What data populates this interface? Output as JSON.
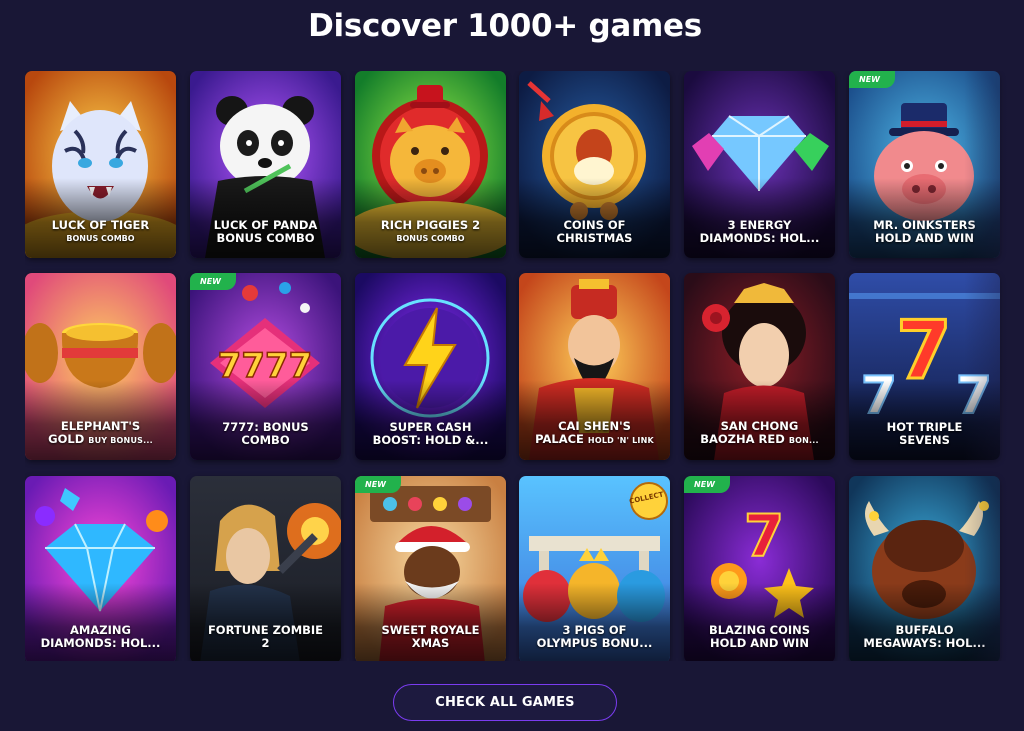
{
  "header": {
    "title": "Discover 1000+ games"
  },
  "badge_text": "NEW",
  "colors": {
    "background": "#191736",
    "new_badge": "#22b24c",
    "cta_border": "#7a3cf0"
  },
  "games": [
    {
      "line1": "LUCK OF TIGER",
      "line2": "BONUS COMBO",
      "line2_style": "sub",
      "new": false,
      "art": "tiger"
    },
    {
      "line1": "LUCK OF PANDA",
      "line2": "BONUS COMBO",
      "line2_style": "main",
      "new": false,
      "art": "panda"
    },
    {
      "line1": "RICH PIGGIES 2",
      "line2": "BONUS COMBO",
      "line2_style": "sub",
      "new": false,
      "art": "piggy"
    },
    {
      "line1": "COINS OF",
      "line2": "CHRISTMAS",
      "line2_style": "main",
      "new": false,
      "art": "coin"
    },
    {
      "line1": "3 ENERGY",
      "line2": "DIAMONDS: HOL...",
      "line2_style": "main",
      "new": false,
      "art": "diamond"
    },
    {
      "line1": "MR. OINKSTERS",
      "line2": "HOLD AND WIN",
      "line2_style": "main",
      "new": true,
      "art": "oink"
    },
    {
      "line1": "ELEPHANT'S",
      "line2": "GOLD",
      "line2_suffix": "BUY BONUS...",
      "line2_style": "main",
      "new": false,
      "art": "pots"
    },
    {
      "line1": "7777: BONUS",
      "line2": "COMBO",
      "line2_style": "main",
      "new": true,
      "art": "sevens4"
    },
    {
      "line1": "SUPER CASH",
      "line2": "BOOST: HOLD &...",
      "line2_style": "main",
      "new": false,
      "art": "bolt"
    },
    {
      "line1": "CAI SHEN'S",
      "line2": "PALACE",
      "line2_suffix": "HOLD 'N' LINK",
      "line2_style": "main",
      "new": false,
      "art": "caishen"
    },
    {
      "line1": "SAN CHONG",
      "line2": "BAOZHA RED",
      "line2_suffix": "BON...",
      "line2_style": "main",
      "new": false,
      "art": "lady"
    },
    {
      "line1": "HOT TRIPLE",
      "line2": "SEVENS",
      "line2_style": "main",
      "new": false,
      "art": "seven3"
    },
    {
      "line1": "AMAZING",
      "line2": "DIAMONDS: HOL...",
      "line2_style": "main",
      "new": false,
      "art": "bigdiamond"
    },
    {
      "line1": "FORTUNE ZOMBIE",
      "line2": "2",
      "line2_style": "main",
      "new": false,
      "art": "zombie"
    },
    {
      "line1": "SWEET ROYALE",
      "line2": "XMAS",
      "line2_style": "main",
      "new": true,
      "art": "santa"
    },
    {
      "line1": "3 PIGS OF",
      "line2": "OLYMPUS BONU...",
      "line2_style": "main",
      "new": false,
      "art": "pigs3",
      "corner_label": "COLLECT"
    },
    {
      "line1": "BLAZING COINS",
      "line2": "HOLD AND WIN",
      "line2_style": "main",
      "new": true,
      "art": "blazing"
    },
    {
      "line1": "BUFFALO",
      "line2": "MEGAWAYS: HOL...",
      "line2_style": "main",
      "new": false,
      "art": "buffalo"
    }
  ],
  "cta": {
    "label": "CHECK ALL GAMES"
  }
}
